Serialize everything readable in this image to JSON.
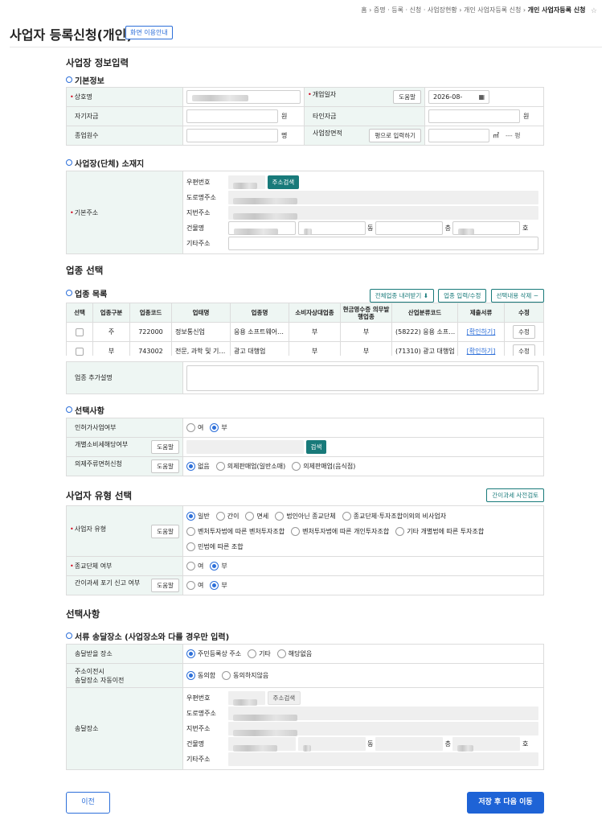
{
  "breadcrumb": {
    "items": [
      "홈",
      "증명 · 등록 · 신청 · 사업장현황",
      "개인 사업자등록 신청"
    ],
    "current": "개인 사업자등록 신청",
    "sep": "›"
  },
  "page_title": "사업자 등록신청(개인)",
  "guide_button": "화면 이용안내",
  "section_business_info": "사업장 정보입력",
  "basic_info": {
    "title": "기본정보",
    "company_label": "상호명",
    "open_date_label": "개업일자",
    "help": "도움말",
    "open_date_value": "2026-08-",
    "capital_label": "자기자금",
    "capital_unit": "원",
    "other_capital_label": "타인자금",
    "other_capital_unit": "원",
    "employees_label": "종업원수",
    "employees_unit": "명",
    "area_label": "사업장면적",
    "pyeong_button": "평으로 입력하기",
    "area_unit": "㎡",
    "pyeong_suffix": "--- 평"
  },
  "location": {
    "title": "사업장(단체) 소재지",
    "addr_label": "기본주소",
    "postcode": "우편번호",
    "search_button": "주소검색",
    "road": "도로명주소",
    "lot": "지번주소",
    "building": "건물명",
    "dong": "동",
    "floor": "층",
    "ho": "호",
    "other": "기타주소"
  },
  "industry": {
    "section": "업종 선택",
    "list_title": "업종 목록",
    "btn_download": "전체업종 내려받기",
    "btn_edit": "업종 입력/수정",
    "btn_delete": "선택내용 삭제",
    "headers": [
      "선택",
      "업종구분",
      "업종코드",
      "업태명",
      "업종명",
      "소비자상대업종",
      "현금영수증 의무발행업종",
      "산업분류코드",
      "제출서류",
      "수정"
    ],
    "rows": [
      {
        "type": "주",
        "code": "722000",
        "biz": "정보통신업",
        "name": "응용 소프트웨어…",
        "consumer": "부",
        "cash": "부",
        "class": "(58222) 응용 소프…",
        "doc": "[확인하기]",
        "edit": "수정"
      },
      {
        "type": "부",
        "code": "743002",
        "biz": "전문, 과학 및 기…",
        "name": "광고 대행업",
        "consumer": "부",
        "cash": "부",
        "class": "(71310) 광고 대행업",
        "doc": "[확인하기]",
        "edit": "수정"
      }
    ],
    "desc_label": "업종 추가설명"
  },
  "options": {
    "title": "선택사항",
    "permit_label": "인허가사업여부",
    "yes": "여",
    "no": "부",
    "excise_label": "개별소비세해당여부",
    "help": "도움말",
    "check_button": "검색",
    "liquor_label": "의제주류면허신청",
    "liquor_opts": [
      "없음",
      "의제판매업(일반소매)",
      "의제판매업(음식점)"
    ]
  },
  "biz_type": {
    "section": "사업자 유형 선택",
    "precheck": "간이과세 사전검토",
    "type_label": "사업자 유형",
    "help": "도움말",
    "opts": [
      "일반",
      "간이",
      "면세",
      "법인아닌 종교단체",
      "종교단체·투자조합이외의 비사업자",
      "벤처투자법에 따른 벤처투자조합",
      "벤처투자법에 따른 개인투자조합",
      "기타 개별법에 따른 투자조합",
      "민법에 따른 조합"
    ],
    "religious_label": "종교단체 여부",
    "waive_label": "간이과세 포기 신고 여부",
    "yes": "여",
    "no": "부"
  },
  "delivery": {
    "section": "선택사항",
    "title": "서류 송달장소 (사업장소와 다를 경우만 입력)",
    "place_label": "송달받을 장소",
    "place_opts": [
      "주민등록상 주소",
      "기타",
      "해당없음"
    ],
    "move_label_1": "주소이전시",
    "move_label_2": "송달장소 자동이전",
    "move_opts": [
      "동의함",
      "동의하지않음"
    ],
    "addr_label": "송달장소",
    "postcode": "우편번호",
    "search_button": "주소검색",
    "road": "도로명주소",
    "lot": "지번주소",
    "building": "건물명",
    "dong": "동",
    "floor": "층",
    "ho": "호",
    "other": "기타주소"
  },
  "footer": {
    "prev": "이전",
    "next": "저장 후 다음 이동"
  },
  "colors": {
    "accent": "#2d6fd9",
    "teal": "#187a7a",
    "label_bg": "#eef6f3"
  }
}
